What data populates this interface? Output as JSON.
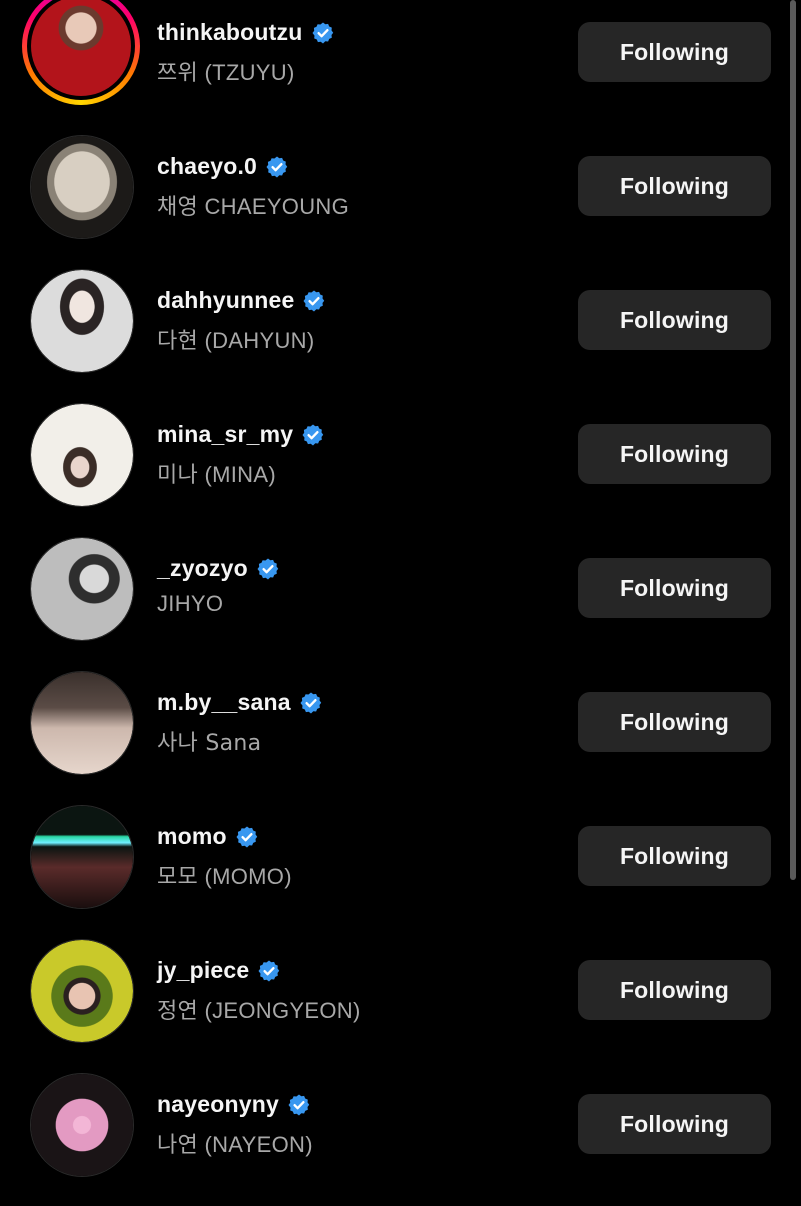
{
  "follow_list": [
    {
      "username": "thinkaboutzu",
      "full_name": "쯔위 (TZUYU)",
      "button": "Following",
      "verified": true,
      "has_story_ring": true,
      "avatar_icon": "profile-photo",
      "avatar_colors": [
        "#b3141b",
        "#e8c9b8"
      ]
    },
    {
      "username": "chaeyo.0",
      "full_name": "채영 CHAEYOUNG",
      "button": "Following",
      "verified": true,
      "has_story_ring": false,
      "avatar_icon": "profile-photo",
      "avatar_colors": [
        "#8a8276",
        "#d8cfc2"
      ]
    },
    {
      "username": "dahhyunnee",
      "full_name": "다현 (DAHYUN)",
      "button": "Following",
      "verified": true,
      "has_story_ring": false,
      "avatar_icon": "profile-photo",
      "avatar_colors": [
        "#dcdcdc",
        "#3a3a3a"
      ]
    },
    {
      "username": "mina_sr_my",
      "full_name": "미나 (MINA)",
      "button": "Following",
      "verified": true,
      "has_story_ring": false,
      "avatar_icon": "profile-photo",
      "avatar_colors": [
        "#f2efe9",
        "#3b2d27"
      ]
    },
    {
      "username": "_zyozyo",
      "full_name": "JIHYO",
      "button": "Following",
      "verified": true,
      "has_story_ring": false,
      "avatar_icon": "profile-photo",
      "avatar_colors": [
        "#bdbdbd",
        "#2e2e2e"
      ]
    },
    {
      "username": "m.by__sana",
      "full_name": "사나 Sana",
      "button": "Following",
      "verified": true,
      "has_story_ring": false,
      "avatar_icon": "profile-photo",
      "avatar_colors": [
        "#3a302c",
        "#cdb8ad"
      ]
    },
    {
      "username": "momo",
      "full_name": "모모 (MOMO)",
      "button": "Following",
      "verified": true,
      "has_story_ring": false,
      "avatar_icon": "profile-photo",
      "avatar_colors": [
        "#0b1511",
        "#29d6a4"
      ]
    },
    {
      "username": "jy_piece",
      "full_name": "정연 (JEONGYEON)",
      "button": "Following",
      "verified": true,
      "has_story_ring": false,
      "avatar_icon": "profile-photo",
      "avatar_colors": [
        "#c9c92a",
        "#5a7a1a"
      ]
    },
    {
      "username": "nayeonyny",
      "full_name": "나연 (NAYEON)",
      "button": "Following",
      "verified": true,
      "has_story_ring": false,
      "avatar_icon": "profile-photo",
      "avatar_colors": [
        "#1a1416",
        "#e39ac2"
      ]
    }
  ],
  "colors": {
    "background": "#000000",
    "button_bg": "#262626",
    "verified_blue": "#3897f0",
    "secondary_text": "#a8a8a8"
  }
}
